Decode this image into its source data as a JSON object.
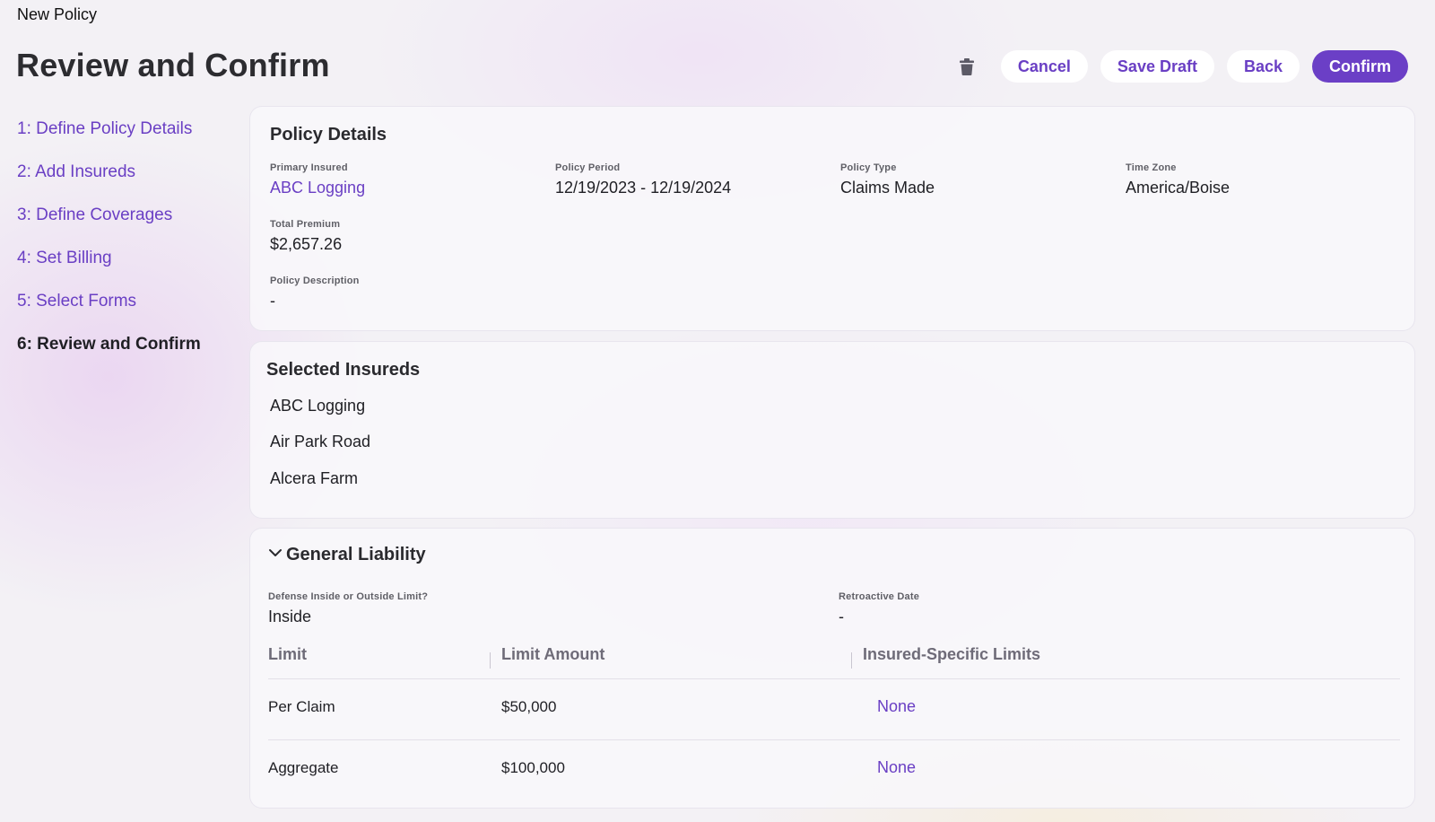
{
  "breadcrumb": "New Policy",
  "page_title": "Review and Confirm",
  "actions": {
    "delete_icon": "trash-icon",
    "cancel": "Cancel",
    "save_draft": "Save Draft",
    "back": "Back",
    "confirm": "Confirm"
  },
  "steps": [
    {
      "label": "1: Define Policy Details",
      "active": false
    },
    {
      "label": "2: Add Insureds",
      "active": false
    },
    {
      "label": "3: Define Coverages",
      "active": false
    },
    {
      "label": "4: Set Billing",
      "active": false
    },
    {
      "label": "5: Select Forms",
      "active": false
    },
    {
      "label": "6: Review and Confirm",
      "active": true
    }
  ],
  "policy_details": {
    "title": "Policy Details",
    "primary_insured": {
      "label": "Primary Insured",
      "value": "ABC Logging"
    },
    "policy_period": {
      "label": "Policy Period",
      "value": "12/19/2023 - 12/19/2024"
    },
    "policy_type": {
      "label": "Policy Type",
      "value": "Claims Made"
    },
    "time_zone": {
      "label": "Time Zone",
      "value": "America/Boise"
    },
    "total_premium": {
      "label": "Total Premium",
      "value": "$2,657.26"
    },
    "policy_description": {
      "label": "Policy Description",
      "value": "-"
    }
  },
  "selected_insureds": {
    "title": "Selected Insureds",
    "items": [
      "ABC Logging",
      "Air Park Road",
      "Alcera Farm"
    ]
  },
  "general_liability": {
    "title": "General Liability",
    "expanded": true,
    "defense": {
      "label": "Defense Inside or Outside Limit?",
      "value": "Inside"
    },
    "retroactive_date": {
      "label": "Retroactive Date",
      "value": "-"
    },
    "columns": [
      "Limit",
      "Limit Amount",
      "Insured-Specific Limits"
    ],
    "rows": [
      {
        "limit": "Per Claim",
        "amount": "$50,000",
        "insured_specific": "None"
      },
      {
        "limit": "Aggregate",
        "amount": "$100,000",
        "insured_specific": "None"
      }
    ]
  },
  "colors": {
    "accent": "#6b3fc6",
    "link": "#6a3fc4",
    "text": "#1f1f24",
    "muted": "#6e6b78"
  }
}
